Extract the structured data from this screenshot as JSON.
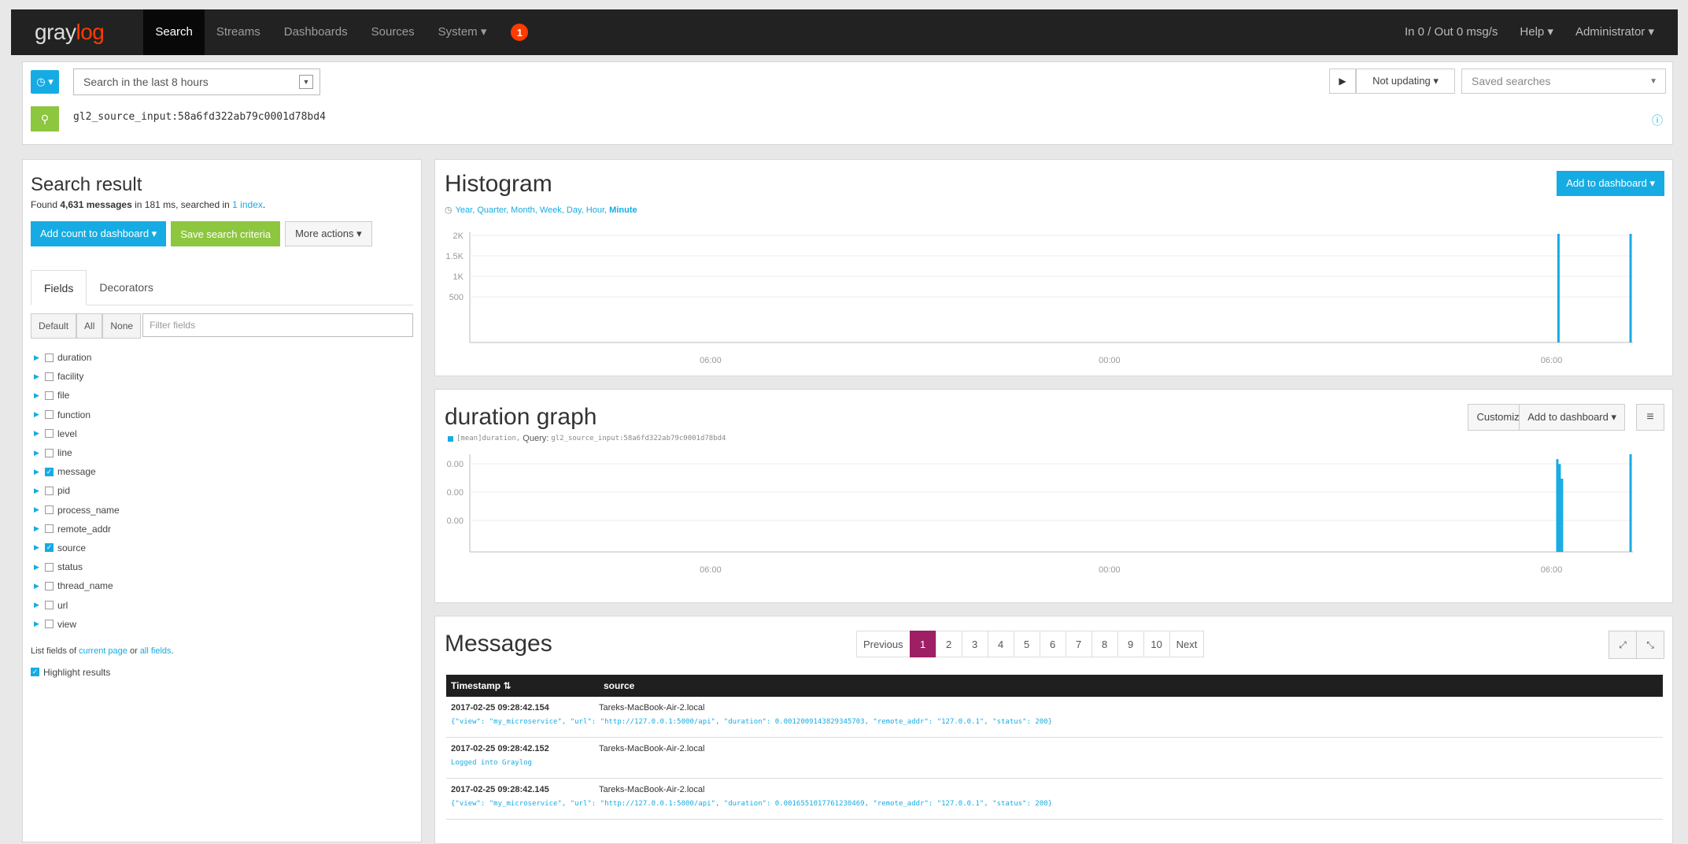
{
  "navbar": {
    "logo_prefix": "gray",
    "logo_suffix": "log",
    "items": [
      "Search",
      "Streams",
      "Dashboards",
      "Sources",
      "System ▾"
    ],
    "notification_count": "1",
    "right_items": [
      "In 0 / Out 0 msg/s",
      "Help ▾",
      "Administrator ▾"
    ]
  },
  "searchbar": {
    "timepicker_icon": "clock-icon",
    "time_range": "Search in the last 8 hours",
    "play_icon": "▶",
    "update_label": "Not updating ▾",
    "saved_placeholder": "Saved searches",
    "query": "gl2_source_input:58a6fd322ab79c0001d78bd4"
  },
  "result": {
    "title": "Search result",
    "found_prefix": "Found ",
    "count": "4,631 messages",
    "found_mid": " in 181 ms, searched in ",
    "index_link": "1 index",
    "found_suffix": ".",
    "add_count_btn": "Add count to dashboard ▾",
    "save_btn": "Save search criteria",
    "more_btn": "More actions ▾",
    "tabs": [
      "Fields",
      "Decorators"
    ],
    "filter_buttons": [
      "Default",
      "All",
      "None"
    ],
    "filter_placeholder": "Filter fields",
    "fields": [
      {
        "name": "duration",
        "checked": false
      },
      {
        "name": "facility",
        "checked": false
      },
      {
        "name": "file",
        "checked": false
      },
      {
        "name": "function",
        "checked": false
      },
      {
        "name": "level",
        "checked": false
      },
      {
        "name": "line",
        "checked": false
      },
      {
        "name": "message",
        "checked": true
      },
      {
        "name": "pid",
        "checked": false
      },
      {
        "name": "process_name",
        "checked": false
      },
      {
        "name": "remote_addr",
        "checked": false
      },
      {
        "name": "source",
        "checked": true
      },
      {
        "name": "status",
        "checked": false
      },
      {
        "name": "thread_name",
        "checked": false
      },
      {
        "name": "url",
        "checked": false
      },
      {
        "name": "view",
        "checked": false
      }
    ],
    "list_prefix": "List fields of ",
    "list_current": "current page",
    "list_or": " or ",
    "list_all": "all fields",
    "list_suffix": ".",
    "highlight_label": "Highlight results"
  },
  "histogram": {
    "title": "Histogram",
    "resolutions": [
      "Year",
      "Quarter",
      "Month",
      "Week",
      "Day",
      "Hour",
      "Minute"
    ],
    "add_btn": "Add to dashboard ▾",
    "chart_data": {
      "type": "bar",
      "y_ticks": [
        "2K",
        "1.5K",
        "1K",
        "500"
      ],
      "x_ticks": [
        "06:00",
        "00:00",
        "06:00"
      ],
      "ylim": [
        0,
        2000
      ],
      "bars": [
        {
          "pos": 0.935,
          "value": 2050
        },
        {
          "pos": 0.997,
          "value": 2050
        }
      ]
    }
  },
  "duration_graph": {
    "title": "duration graph",
    "legend_field": "[mean]duration,",
    "legend_query_label": "Query:",
    "legend_query": "gl2_source_input:58a6fd322ab79c0001d78bd4",
    "customize_btn": "Customize ▾",
    "add_btn": "Add to dashboard ▾",
    "menu_icon": "≡",
    "chart_data": {
      "type": "bar",
      "y_ticks": [
        "0.00",
        "0.00",
        "0.00"
      ],
      "x_ticks": [
        "06:00",
        "00:00",
        "06:00"
      ],
      "bars": [
        {
          "pos": 0.934,
          "value": 0.95
        },
        {
          "pos": 0.936,
          "value": 0.9
        },
        {
          "pos": 0.938,
          "value": 0.75
        },
        {
          "pos": 0.997,
          "value": 1.0
        }
      ]
    }
  },
  "messages": {
    "title": "Messages",
    "pagination": [
      "Previous",
      "1",
      "2",
      "3",
      "4",
      "5",
      "6",
      "7",
      "8",
      "9",
      "10",
      "Next"
    ],
    "active_page": "1",
    "columns": [
      "Timestamp ⇅",
      "source"
    ],
    "rows": [
      {
        "timestamp": "2017-02-25 09:28:42.154",
        "source": "Tareks-MacBook-Air-2.local",
        "message": "{\"view\": \"my_microservice\", \"url\": \"http://127.0.0.1:5000/api\", \"duration\": 0.0012009143829345703, \"remote_addr\": \"127.0.0.1\", \"status\": 200}"
      },
      {
        "timestamp": "2017-02-25 09:28:42.152",
        "source": "Tareks-MacBook-Air-2.local",
        "message": "Logged into Graylog"
      },
      {
        "timestamp": "2017-02-25 09:28:42.145",
        "source": "Tareks-MacBook-Air-2.local",
        "message": "{\"view\": \"my_microservice\", \"url\": \"http://127.0.0.1:5000/api\", \"duration\": 0.0016551017761230469, \"remote_addr\": \"127.0.0.1\", \"status\": 200}"
      }
    ]
  }
}
